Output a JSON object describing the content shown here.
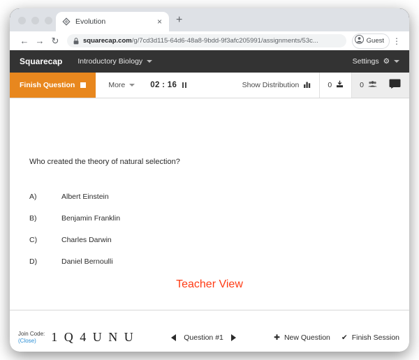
{
  "browser": {
    "tab": {
      "title": "Evolution",
      "favicon": "diamond-icon",
      "close": "×"
    },
    "new_tab": "+",
    "nav": {
      "back": "←",
      "forward": "→",
      "reload": "↻"
    },
    "omnibox": {
      "lock": "lock-icon",
      "host": "squarecap.com",
      "path": "/g/7cd3d115-64d6-48a8-9bdd-9f3afc205991/assignments/53c..."
    },
    "profile": {
      "name": "Guest",
      "avatar": "person-icon"
    },
    "menu": "⋮"
  },
  "app_nav": {
    "brand": "Squarecap",
    "course": "Introductory Biology",
    "settings": "Settings",
    "gear": "⚙"
  },
  "action_bar": {
    "finish_question": "Finish Question",
    "more": "More",
    "timer": "02 : 16",
    "show_distribution": "Show Distribution",
    "submissions_count": "0",
    "participants_count": "0",
    "chat_icon": "chat-icon"
  },
  "question": {
    "text": "Who created the theory of natural selection?",
    "choices": [
      {
        "letter": "A)",
        "text": "Albert Einstein"
      },
      {
        "letter": "B)",
        "text": "Benjamin Franklin"
      },
      {
        "letter": "C)",
        "text": "Charles Darwin"
      },
      {
        "letter": "D)",
        "text": "Daniel Bernoulli"
      }
    ],
    "watermark": "Teacher View"
  },
  "bottom_bar": {
    "join_code_label": "Join Code:",
    "join_code_close": "(Close)",
    "join_code_value": "1 Q 4 U N U",
    "question_label": "Question #1",
    "new_question": "New Question",
    "finish_session": "Finish Session",
    "plus": "✚",
    "check": "✔"
  },
  "colors": {
    "accent_orange": "#e8871e",
    "nav_dark": "#333333",
    "watermark_red": "#ff3b14",
    "link_blue": "#2b8fd6"
  }
}
